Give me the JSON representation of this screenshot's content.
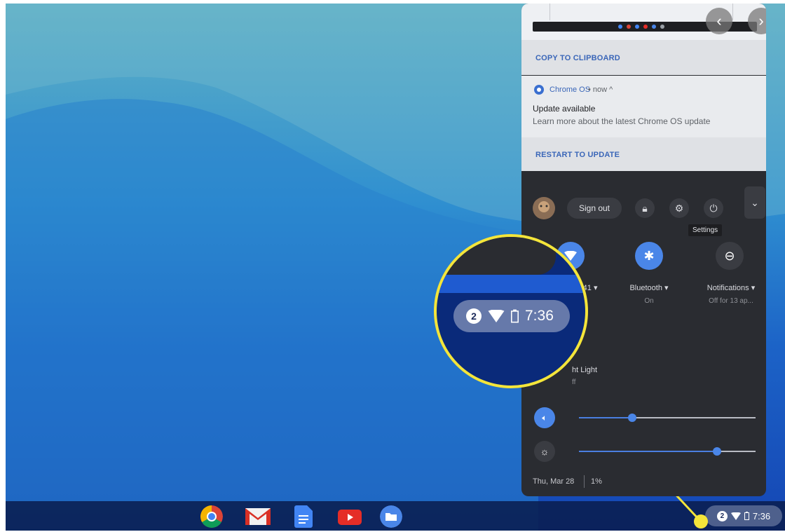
{
  "panel": {
    "copy_action": "COPY TO CLIPBOARD",
    "notification": {
      "source": "Chrome OS",
      "time": "• now ^",
      "title": "Update available",
      "body": "Learn more about the latest Chrome OS update",
      "action": "RESTART TO UPDATE"
    },
    "sign_out": "Sign out",
    "tooltip": "Settings",
    "features": [
      {
        "label": "841 ▾",
        "sublabel": ""
      },
      {
        "label": "Bluetooth ▾",
        "sublabel": "On"
      },
      {
        "label": "Notifications ▾",
        "sublabel": "Off for 13 ap..."
      },
      {
        "label": "ht Light",
        "sublabel": "ff"
      }
    ],
    "volume_level": 0.3,
    "brightness_level": 0.78,
    "date": "Thu, Mar 28",
    "battery": "1%"
  },
  "tray": {
    "badge_count": "2",
    "time": "7:36"
  },
  "zoom": {
    "badge_count": "2",
    "time": "7:36"
  },
  "shelf_apps": [
    "chrome-icon",
    "gmail-icon",
    "docs-icon",
    "youtube-icon",
    "files-icon"
  ],
  "colors": {
    "accent": "#4a86e8",
    "highlight": "#f4e53a",
    "panel": "#2a2c31"
  }
}
